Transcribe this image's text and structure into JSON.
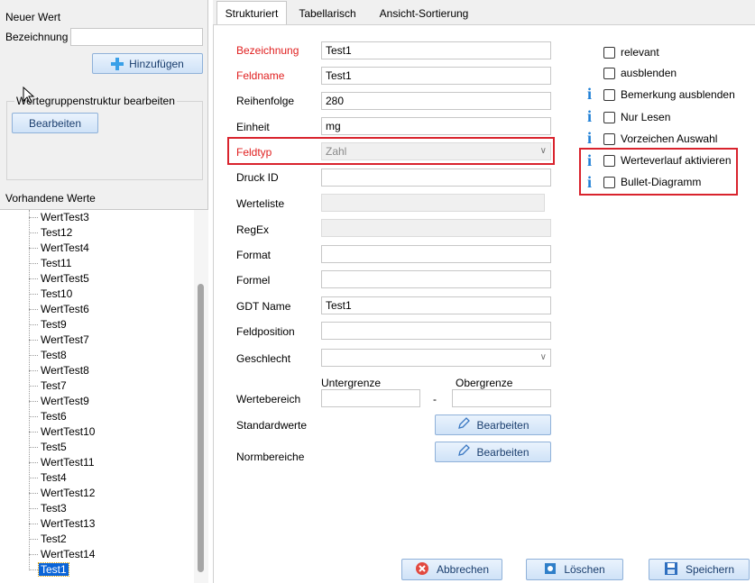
{
  "left": {
    "new_value_label": "Neuer Wert",
    "name_label": "Bezeichnung",
    "name_value": "",
    "add_button": "Hinzufügen",
    "groupbox_title": "Wertegruppenstruktur bearbeiten",
    "edit_button": "Bearbeiten",
    "existing_label": "Vorhandene Werte",
    "tree_items": [
      "WertTest3",
      "Test12",
      "WertTest4",
      "Test11",
      "WertTest5",
      "Test10",
      "WertTest6",
      "Test9",
      "WertTest7",
      "Test8",
      "WertTest8",
      "Test7",
      "WertTest9",
      "Test6",
      "WertTest10",
      "Test5",
      "WertTest11",
      "Test4",
      "WertTest12",
      "Test3",
      "WertTest13",
      "Test2",
      "WertTest14",
      "Test1"
    ],
    "selected_item": "Test1"
  },
  "tabs": [
    "Strukturiert",
    "Tabellarisch",
    "Ansicht-Sortierung"
  ],
  "form": {
    "bezeichnung_label": "Bezeichnung",
    "bezeichnung_value": "Test1",
    "feldname_label": "Feldname",
    "feldname_value": "Test1",
    "reihenfolge_label": "Reihenfolge",
    "reihenfolge_value": "280",
    "einheit_label": "Einheit",
    "einheit_value": "mg",
    "feldtyp_label": "Feldtyp",
    "feldtyp_value": "Zahl",
    "druckid_label": "Druck ID",
    "druckid_value": "",
    "werteliste_label": "Werteliste",
    "regex_label": "RegEx",
    "format_label": "Format",
    "formel_label": "Formel",
    "gdt_label": "GDT Name",
    "gdt_value": "Test1",
    "feldposition_label": "Feldposition",
    "geschlecht_label": "Geschlecht",
    "geschlecht_value": "",
    "untergrenze_label": "Untergrenze",
    "obergrenze_label": "Obergrenze",
    "wertebereich_label": "Wertebereich",
    "range_separator": "-",
    "standardwerte_label": "Standardwerte",
    "normbereiche_label": "Normbereiche",
    "edit_label": "Bearbeiten"
  },
  "options": {
    "relevant": "relevant",
    "ausblenden": "ausblenden",
    "bemerkung": "Bemerkung ausblenden",
    "nurlesen": "Nur Lesen",
    "vorzeichen": "Vorzeichen Auswahl",
    "werteverlauf": "Werteverlauf aktivieren",
    "bullet": "Bullet-Diagramm",
    "info_glyph": "i"
  },
  "buttons": {
    "cancel": "Abbrechen",
    "delete": "Löschen",
    "save": "Speichern"
  },
  "colors": {
    "required_label": "#e02020",
    "highlight": "#d9232d",
    "info": "#1e7fd6",
    "selection": "#0a64d8"
  }
}
